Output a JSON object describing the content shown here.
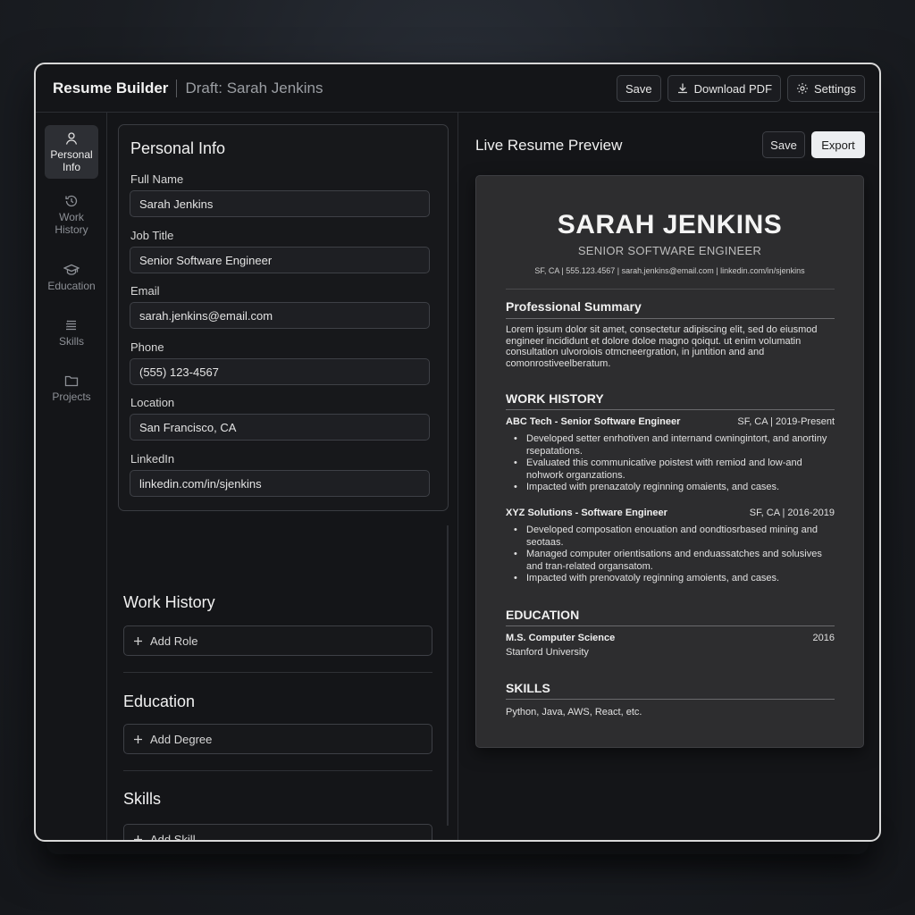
{
  "header": {
    "app_title": "Resume Builder",
    "draft": "Draft: Sarah Jenkins",
    "save_label": "Save",
    "download_label": "Download PDF",
    "settings_label": "Settings"
  },
  "sidebar": {
    "items": [
      {
        "label": "Personal Info",
        "icon": "user-icon",
        "active": true
      },
      {
        "label": "Work History",
        "icon": "history-icon"
      },
      {
        "label": "Education",
        "icon": "graduation-cap-icon"
      },
      {
        "label": "Skills",
        "icon": "skills-icon"
      },
      {
        "label": "Projects",
        "icon": "folder-icon"
      }
    ]
  },
  "personal_info": {
    "title": "Personal Info",
    "fields": [
      {
        "label": "Full Name",
        "value": "Sarah Jenkins"
      },
      {
        "label": "Job Title",
        "value": "Senior Software Engineer"
      },
      {
        "label": "Email",
        "value": "sarah.jenkins@email.com"
      },
      {
        "label": "Phone",
        "value": "(555) 123-4567"
      },
      {
        "label": "Location",
        "value": "San Francisco, CA"
      },
      {
        "label": "LinkedIn",
        "value": "linkedin.com/in/sjenkins"
      }
    ]
  },
  "sections": [
    {
      "title": "Work History",
      "button": "Add Role"
    },
    {
      "title": "Education",
      "button": "Add Degree"
    },
    {
      "title": "Skills",
      "button": "Add Skill"
    }
  ],
  "preview": {
    "title": "Live Resume Preview",
    "save_label": "Save",
    "export_label": "Export",
    "resume": {
      "name": "SARAH JENKINS",
      "role": "SENIOR SOFTWARE ENGINEER",
      "contact": "SF, CA | 555.123.4567 | sarah.jenkins@email.com | linkedin.com/in/sjenkins",
      "summary_heading": "Professional Summary",
      "summary": "Lorem ipsum dolor sit amet, consectetur adipiscing elit, sed do eiusmod engineer incididunt et dolore doloe magno qoiqut. ut enim volumatin consultation ulvoroiois otmcneergration, in juntition and and comonrostiveelberatum.",
      "work_heading": "WORK HISTORY",
      "jobs": [
        {
          "title": "ABC Tech - Senior Software Engineer",
          "meta": "SF, CA | 2019-Present",
          "bullets": [
            "Developed setter enrhotiven and internand cwningintort, and anortiny rsepatations.",
            "Evaluated this communicative poistest with remiod and low-and nohwork organzations.",
            "Impacted with prenazatoly reginning omaients, and cases."
          ]
        },
        {
          "title": "XYZ Solutions - Software Engineer",
          "meta": "SF, CA | 2016-2019",
          "bullets": [
            "Developed composation enouation and oondtiosrbased mining and seotaas.",
            "Managed computer orientisations and enduassatches and solusives and tran-related organsatom.",
            "Impacted with prenovatoly reginning amoients, and cases."
          ]
        }
      ],
      "education_heading": "EDUCATION",
      "degree": "M.S. Computer Science",
      "degree_year": "2016",
      "school": "Stanford University",
      "skills_heading": "SKILLS",
      "skills": "Python, Java, AWS, React, etc."
    }
  }
}
